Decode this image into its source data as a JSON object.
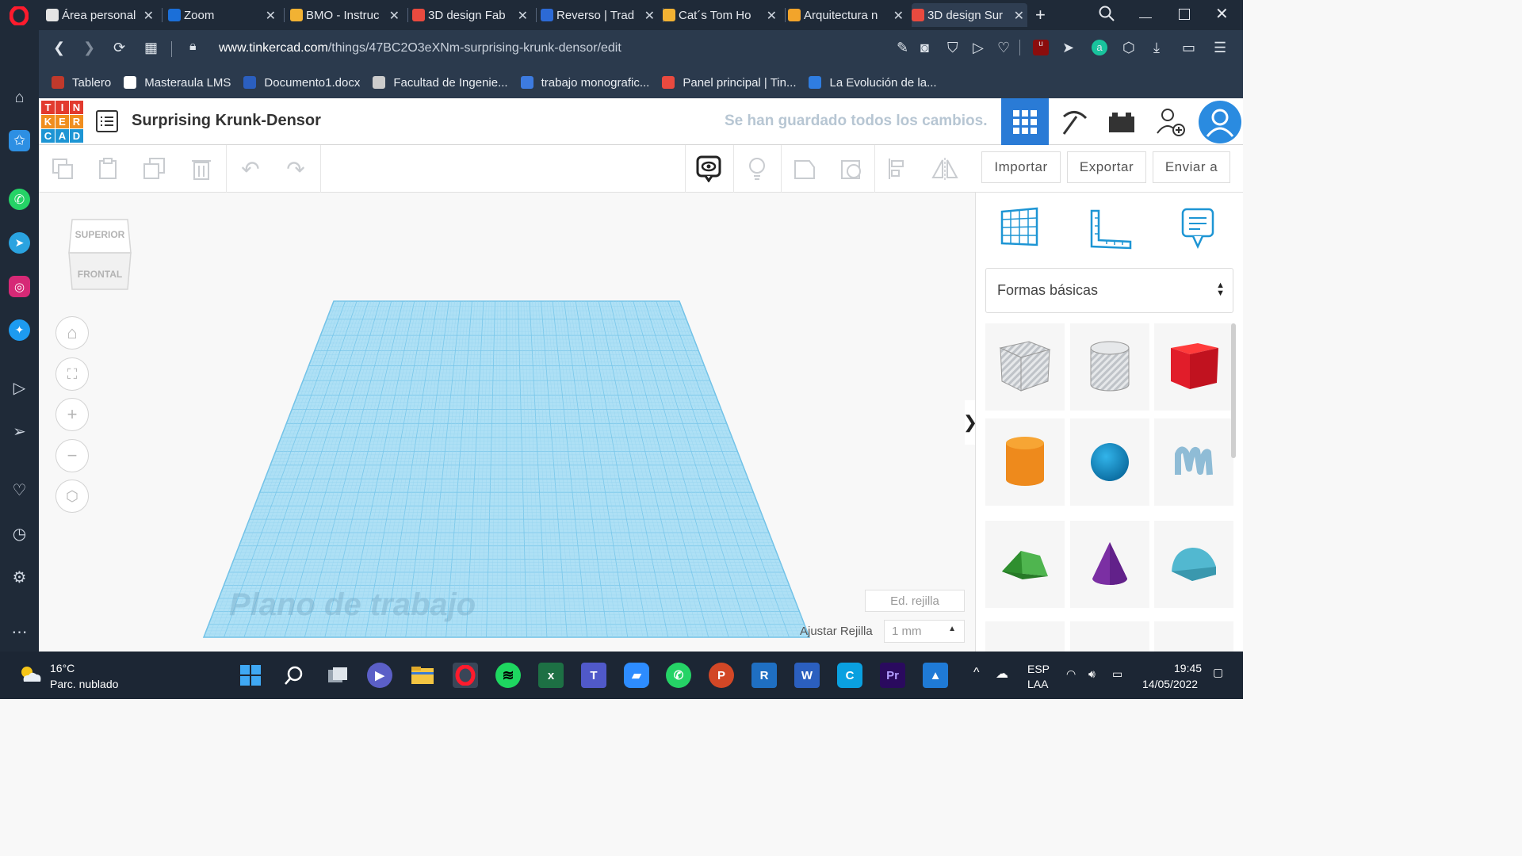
{
  "browser": {
    "tabs": [
      {
        "title": "Área personal",
        "color": "#e4e4e4"
      },
      {
        "title": "Zoom",
        "color": "#1b6fd8"
      },
      {
        "title": "BMO - Instruc",
        "color": "#f2b233"
      },
      {
        "title": "3D design Fab",
        "color": "#e94a3f"
      },
      {
        "title": "Reverso | Trad",
        "color": "#2c6ad6"
      },
      {
        "title": "Cat´s Tom Ho",
        "color": "#f2b233"
      },
      {
        "title": "Arquitectura n",
        "color": "#f2a42b"
      },
      {
        "title": "3D design Sur",
        "color": "#e94a3f"
      }
    ],
    "url_host": "www.tinkercad.com",
    "url_path": "/things/47BC2O3eXNm-surprising-krunk-densor/edit",
    "bookmarks": [
      {
        "label": "Tablero",
        "color": "#c0392b"
      },
      {
        "label": "Masteraula LMS",
        "color": "#ffffff"
      },
      {
        "label": "Documento1.docx",
        "color": "#2b5fbf"
      },
      {
        "label": "Facultad de Ingenie...",
        "color": "#cccccc"
      },
      {
        "label": "trabajo monografic...",
        "color": "#3d7be0"
      },
      {
        "label": "Panel principal | Tin...",
        "color": "#e94a3f"
      },
      {
        "label": "La Evolución de la...",
        "color": "#2f7de1"
      }
    ]
  },
  "app": {
    "logo_letters": [
      "T",
      "I",
      "N",
      "K",
      "E",
      "R",
      "C",
      "A",
      "D"
    ],
    "design_title": "Surprising Krunk-Densor",
    "save_status": "Se han guardado todos los cambios.",
    "toolbar": {
      "import_label": "Importar",
      "export_label": "Exportar",
      "send_label": "Enviar a"
    },
    "viewcube": {
      "top": "SUPERIOR",
      "front": "FRONTAL"
    },
    "workplane_label": "Plano de trabajo",
    "edit_grid_label": "Ed. rejilla",
    "snap_grid_label": "Ajustar Rejilla",
    "snap_grid_value": "1 mm",
    "shape_category": "Formas básicas",
    "shapes": [
      "box-hole",
      "cylinder-hole",
      "box",
      "cylinder",
      "sphere",
      "scribble",
      "roof",
      "cone",
      "round-roof"
    ]
  },
  "taskbar": {
    "weather_temp": "16°C",
    "weather_desc": "Parc. nublado",
    "lang_top": "ESP",
    "lang_bottom": "LAA",
    "time": "19:45",
    "date": "14/05/2022"
  },
  "colors": {
    "accent": "#2a7bd6",
    "grid": "#8fd0ef",
    "box": "#e11d2a",
    "cylinder": "#ee8a1c",
    "sphere": "#1591cd",
    "roof": "#3aa23a",
    "cone": "#7b2fa3",
    "roundroof": "#52b8d0"
  }
}
